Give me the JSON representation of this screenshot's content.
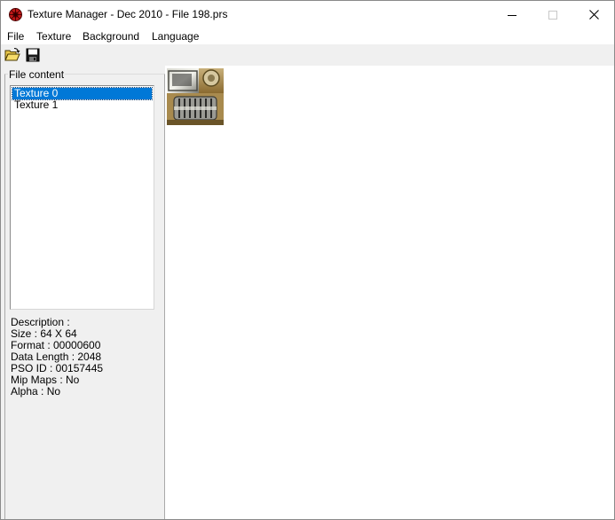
{
  "window": {
    "title": "Texture Manager - Dec 2010 - File 198.prs",
    "controls": {
      "minimize": "minimize",
      "maximize": "maximize",
      "close": "close"
    }
  },
  "menu": {
    "items": [
      "File",
      "Texture",
      "Background",
      "Language"
    ]
  },
  "toolbar": {
    "buttons": [
      {
        "icon": "open-folder-icon"
      },
      {
        "icon": "save-disk-icon"
      }
    ]
  },
  "file_content": {
    "label": "File content",
    "items": [
      {
        "label": "Texture 0",
        "selected": true
      },
      {
        "label": "Texture 1",
        "selected": false
      }
    ]
  },
  "description": {
    "heading": "Description :",
    "size": "Size : 64 X 64",
    "format": "Format : 00000600",
    "data_length": "Data Length : 2048",
    "pso_id": "PSO ID : 00157445",
    "mip_maps": "Mip Maps : No",
    "alpha": "Alpha : No"
  },
  "colors": {
    "selection": "#0078d7",
    "panel_bg": "#f0f0f0",
    "app_icon": "#c01818"
  }
}
